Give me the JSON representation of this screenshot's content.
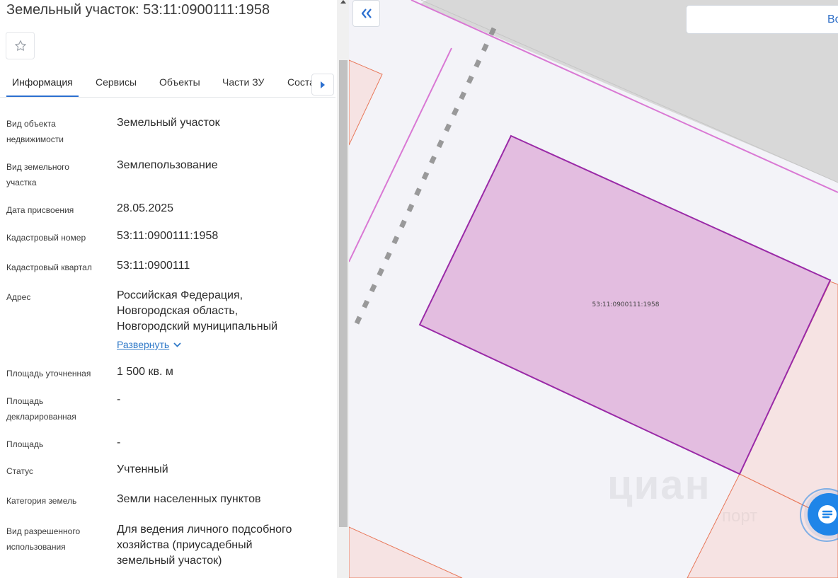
{
  "panel": {
    "title": "Земельный участок: 53:11:0900111:1958",
    "favorite_icon": "star-outline-icon",
    "tabs": [
      {
        "label": "Информация",
        "active": true
      },
      {
        "label": "Сервисы"
      },
      {
        "label": "Объекты"
      },
      {
        "label": "Части ЗУ"
      },
      {
        "label": "Соста"
      }
    ],
    "tabs_next_icon": "triangle-right-icon",
    "rows": {
      "object_type": {
        "label_1": "Вид объекта",
        "label_2": "недвижимости",
        "value": "Земельный участок"
      },
      "land_kind": {
        "label_1": "Вид земельного",
        "label_2": "участка",
        "value": "Землепользование"
      },
      "assign_date": {
        "label": "Дата присвоения",
        "value": "28.05.2025"
      },
      "cad_number": {
        "label": "Кадастровый номер",
        "value": "53:11:0900111:1958"
      },
      "cad_quarter": {
        "label": "Кадастровый квартал",
        "value": "53:11:0900111"
      },
      "address": {
        "label": "Адрес",
        "line_1": "Российская Федерация,",
        "line_2": "Новгородская область,",
        "line_3": "Новгородский муниципальный",
        "expand": "Развернуть"
      },
      "area_refined": {
        "label": "Площадь уточненная",
        "value": "1 500 кв. м"
      },
      "area_declared": {
        "label_1": "Площадь",
        "label_2": "декларированная",
        "value": "-"
      },
      "area": {
        "label": "Площадь",
        "value": "-"
      },
      "status": {
        "label": "Статус",
        "value": "Учтенный"
      },
      "land_category": {
        "label": "Категория земель",
        "value": "Земли населенных пунктов"
      },
      "permitted_use": {
        "label_1": "Вид разрешенного",
        "label_2": "использования",
        "line_1": "Для ведения личного подсобного",
        "line_2": "хозяйства (приусадебный",
        "line_3": "земельный участок)"
      }
    }
  },
  "map": {
    "collapse_icon": "double-chevron-left-icon",
    "parcel_label": "53:11:0900111:1958",
    "search_text": "Во",
    "chat_icon": "chat-lines-icon",
    "watermark": "циан",
    "watermark_sub": "порт",
    "colors": {
      "accent": "#2b6fcf",
      "parcel_fill": "#e3bde0",
      "parcel_stroke": "#9a2aa7",
      "boundary": "#d978d4",
      "neighbor_fill": "#f6e3e3",
      "neighbor_stroke": "#e8785a",
      "road": "#d6d6d6"
    }
  }
}
